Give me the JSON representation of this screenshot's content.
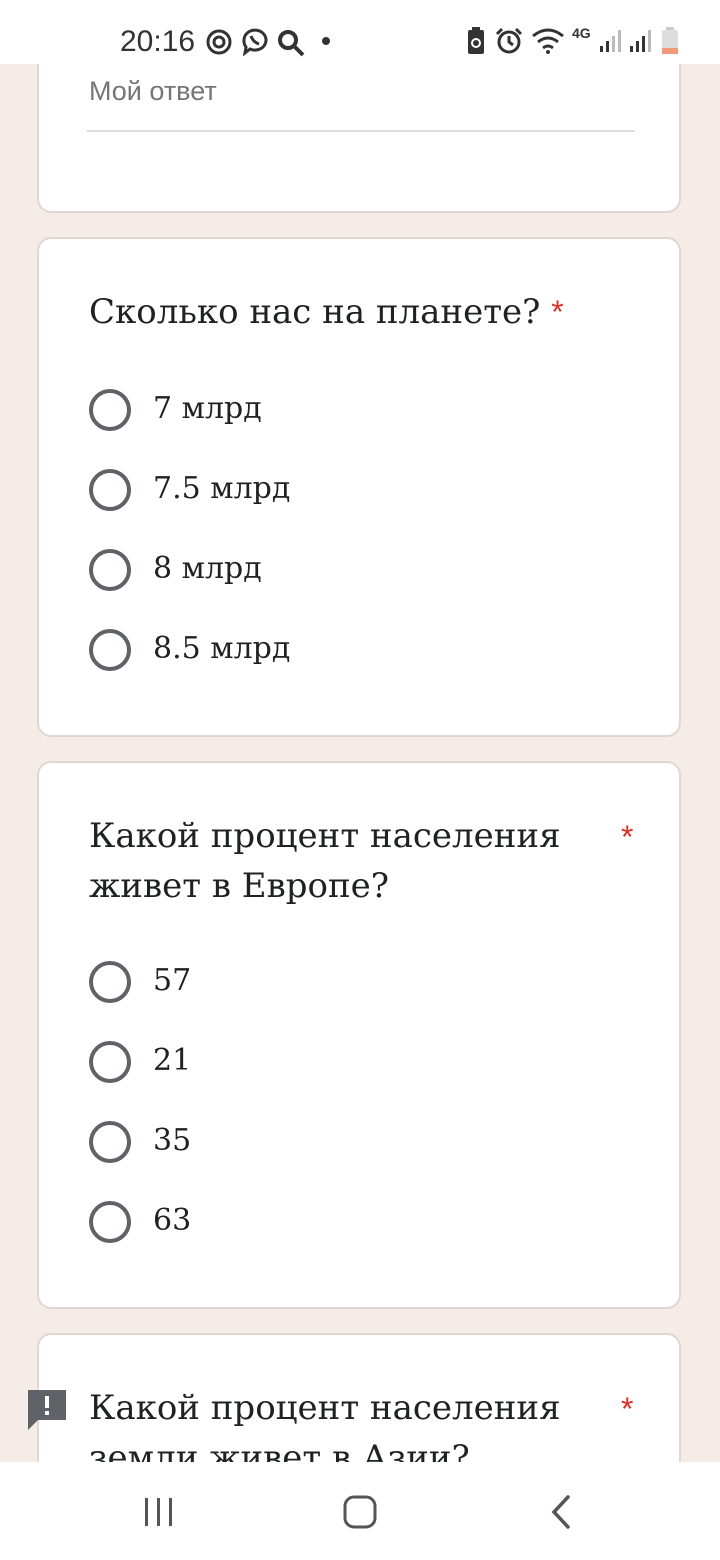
{
  "status_bar": {
    "time": "20:16",
    "network": "4G",
    "icons": [
      "face-id-icon",
      "viber-icon",
      "search-icon",
      "dot-icon",
      "battery-saver-icon",
      "alarm-icon",
      "wifi-icon",
      "4g-icon",
      "signal-icon",
      "signal-icon-2",
      "battery-icon"
    ]
  },
  "colors": {
    "page_bg": "#f5ece7",
    "required": "#d93025",
    "radio": "#5f6368"
  },
  "card_answer": {
    "placeholder": "Мой ответ"
  },
  "questions": [
    {
      "title": "Сколько нас на планете?",
      "required_mark": "*",
      "options": [
        "7 млрд",
        "7.5 млрд",
        "8 млрд",
        "8.5 млрд"
      ]
    },
    {
      "title_line1": "Какой процент населения",
      "title_line2": "живет в Европе?",
      "required_mark": "*",
      "options": [
        "57",
        "21",
        "35",
        "63"
      ]
    },
    {
      "title_line1": "Какой процент населения",
      "title_line2": "земли живет в Азии?",
      "required_mark": "*"
    }
  ],
  "nav": {
    "icons": [
      "recent-apps-icon",
      "home-icon",
      "back-icon"
    ]
  }
}
